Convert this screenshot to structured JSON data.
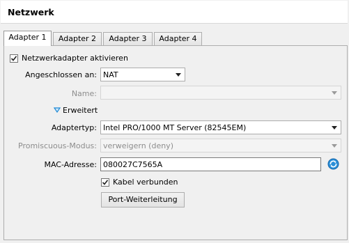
{
  "header": {
    "title": "Netzwerk"
  },
  "tabs": [
    {
      "label": "Adapter 1",
      "active": true
    },
    {
      "label": "Adapter 2",
      "active": false
    },
    {
      "label": "Adapter 3",
      "active": false
    },
    {
      "label": "Adapter 4",
      "active": false
    }
  ],
  "adapter": {
    "enable_label": "Netzwerkadapter aktivieren",
    "enable_checked": true,
    "attached_label": "Angeschlossen an:",
    "attached_value": "NAT",
    "name_label": "Name:",
    "name_value": "",
    "advanced_label": "Erweitert",
    "type_label": "Adaptertyp:",
    "type_value": "Intel PRO/1000 MT Server (82545EM)",
    "promisc_label": "Promiscuous-Modus:",
    "promisc_value": "verweigern (deny)",
    "mac_label": "MAC-Adresse:",
    "mac_value": "080027C7565A",
    "cable_label": "Kabel verbunden",
    "cable_checked": true,
    "port_forward_label": "Port-Weiterleitung"
  },
  "icons": {
    "refresh": "refresh-icon",
    "expand": "triangle-down-icon",
    "accent": "#1e8ad6"
  }
}
